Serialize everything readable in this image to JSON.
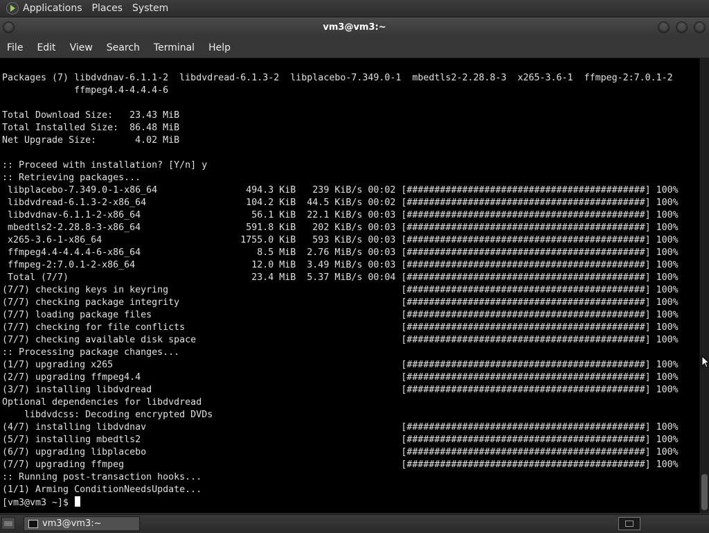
{
  "top_panel": {
    "menus": [
      "Applications",
      "Places",
      "System"
    ]
  },
  "window": {
    "title": "vm3@vm3:~"
  },
  "menubar": {
    "items": [
      "File",
      "Edit",
      "View",
      "Search",
      "Terminal",
      "Help"
    ]
  },
  "terminal": {
    "lines": [
      "Packages (7) libdvdnav-6.1.1-2  libdvdread-6.1.3-2  libplacebo-7.349.0-1  mbedtls2-2.28.8-3  x265-3.6-1  ffmpeg-2:7.0.1-2",
      "             ffmpeg4.4-4.4.4-6",
      "",
      "Total Download Size:   23.43 MiB",
      "Total Installed Size:  86.48 MiB",
      "Net Upgrade Size:       4.02 MiB",
      "",
      ":: Proceed with installation? [Y/n] y",
      ":: Retrieving packages...",
      " libplacebo-7.349.0-1-x86_64                494.3 KiB   239 KiB/s 00:02 [###########################################] 100%",
      " libdvdread-6.1.3-2-x86_64                  104.2 KiB  44.5 KiB/s 00:02 [###########################################] 100%",
      " libdvdnav-6.1.1-2-x86_64                    56.1 KiB  22.1 KiB/s 00:03 [###########################################] 100%",
      " mbedtls2-2.28.8-3-x86_64                   591.8 KiB   202 KiB/s 00:03 [###########################################] 100%",
      " x265-3.6-1-x86_64                         1755.0 KiB   593 KiB/s 00:03 [###########################################] 100%",
      " ffmpeg4.4-4.4.4-6-x86_64                     8.5 MiB  2.76 MiB/s 00:03 [###########################################] 100%",
      " ffmpeg-2:7.0.1-2-x86_64                     12.0 MiB  3.49 MiB/s 00:03 [###########################################] 100%",
      " Total (7/7)                                 23.4 MiB  5.37 MiB/s 00:04 [###########################################] 100%",
      "(7/7) checking keys in keyring                                          [###########################################] 100%",
      "(7/7) checking package integrity                                        [###########################################] 100%",
      "(7/7) loading package files                                             [###########################################] 100%",
      "(7/7) checking for file conflicts                                       [###########################################] 100%",
      "(7/7) checking available disk space                                     [###########################################] 100%",
      ":: Processing package changes...",
      "(1/7) upgrading x265                                                    [###########################################] 100%",
      "(2/7) upgrading ffmpeg4.4                                               [###########################################] 100%",
      "(3/7) installing libdvdread                                             [###########################################] 100%",
      "Optional dependencies for libdvdread",
      "    libdvdcss: Decoding encrypted DVDs",
      "(4/7) installing libdvdnav                                              [###########################################] 100%",
      "(5/7) installing mbedtls2                                               [###########################################] 100%",
      "(6/7) upgrading libplacebo                                              [###########################################] 100%",
      "(7/7) upgrading ffmpeg                                                  [###########################################] 100%",
      ":: Running post-transaction hooks...",
      "(1/1) Arming ConditionNeedsUpdate...",
      "[vm3@vm3 ~]$ "
    ]
  },
  "taskbar": {
    "window_label": "vm3@vm3:~"
  },
  "icons": {
    "app_logo": "app-logo-icon",
    "window_buttons": [
      "minimize-icon",
      "maximize-icon",
      "close-icon"
    ],
    "taskbar_terminal": "terminal-icon",
    "show_desktop": "show-desktop-icon",
    "workspace": "workspace-switcher-icon"
  }
}
